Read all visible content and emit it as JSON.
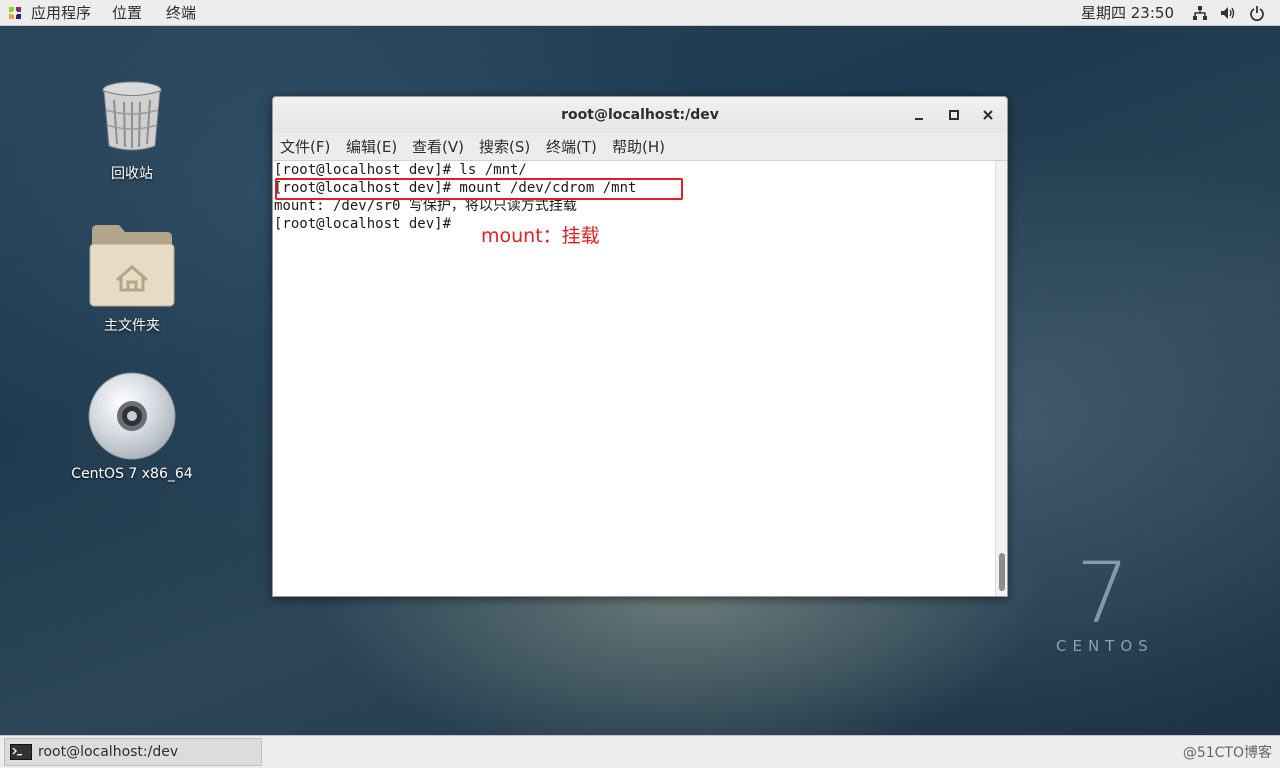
{
  "topbar": {
    "applications": "应用程序",
    "places": "位置",
    "terminal": "终端",
    "clock": "星期四 23:50",
    "icons": [
      "network-icon",
      "volume-icon",
      "power-icon"
    ]
  },
  "desktop": {
    "icons": [
      {
        "label": "回收站",
        "icon": "trash-icon"
      },
      {
        "label": "主文件夹",
        "icon": "home-folder-icon"
      },
      {
        "label": "CentOS 7 x86_64",
        "icon": "disc-icon"
      }
    ],
    "brand_number": "7",
    "brand_word": "CENTOS"
  },
  "window": {
    "title": "root@localhost:/dev",
    "menu": [
      "文件(F)",
      "编辑(E)",
      "查看(V)",
      "搜索(S)",
      "终端(T)",
      "帮助(H)"
    ],
    "lines": [
      "[root@localhost dev]# ls /mnt/",
      "[root@localhost dev]# mount /dev/cdrom /mnt",
      "mount: /dev/sr0 写保护，将以只读方式挂载",
      "[root@localhost dev]# "
    ],
    "annotation": "mount：挂载"
  },
  "taskbar": {
    "item": "root@localhost:/dev",
    "watermark": "@51CTO博客"
  },
  "colors": {
    "annotation": "#e02020",
    "panel": "#ededed"
  }
}
